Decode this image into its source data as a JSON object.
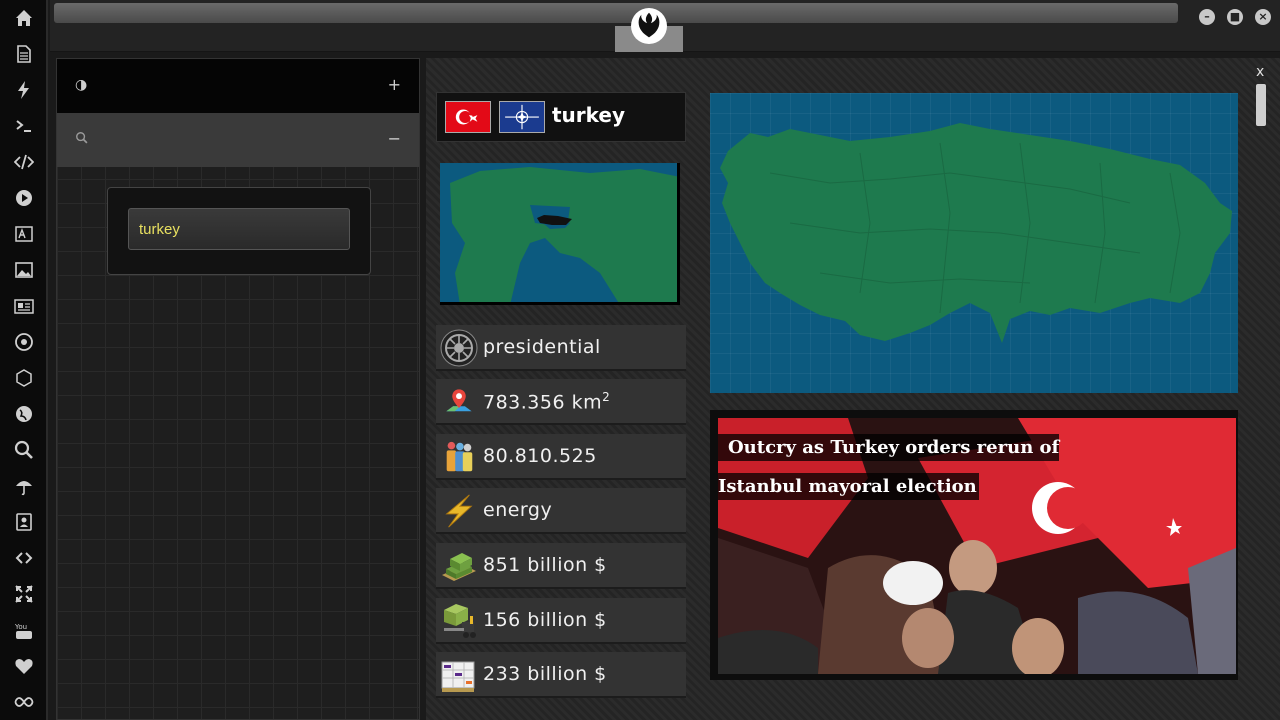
{
  "app": {
    "window_controls": {
      "minimize": "–",
      "maximize": "■",
      "close": "×"
    },
    "rail_icons": [
      "home-icon",
      "file-icon",
      "bolt-icon",
      "terminal-icon",
      "code-icon",
      "play-icon",
      "translate-icon",
      "image-icon",
      "newspaper-icon",
      "empire-icon",
      "network-icon",
      "globe-icon",
      "search-icon",
      "umbrella-icon",
      "contacts-icon",
      "link-icon",
      "expand-icon",
      "youtube-icon",
      "heart-icon",
      "infinity-icon"
    ]
  },
  "sidebar": {
    "row1_toggle": "+",
    "row2_toggle": "−",
    "search_value": "turkey"
  },
  "main": {
    "close_label": "x",
    "country": {
      "name": "turkey"
    },
    "stats": {
      "government": "presidential",
      "area_value": "783.356 km",
      "area_unit_sup": "2",
      "population": "80.810.525",
      "sector": "energy",
      "gdp": "851 billion $",
      "import": "156 billion $",
      "export": "233 billion $"
    },
    "news": {
      "headline": "Outcry as Turkey orders rerun of Istanbul mayoral election"
    }
  },
  "colors": {
    "accent_input_text": "#e8e060",
    "map_water": "#0c5a7f",
    "map_land": "#1e7a4e"
  }
}
